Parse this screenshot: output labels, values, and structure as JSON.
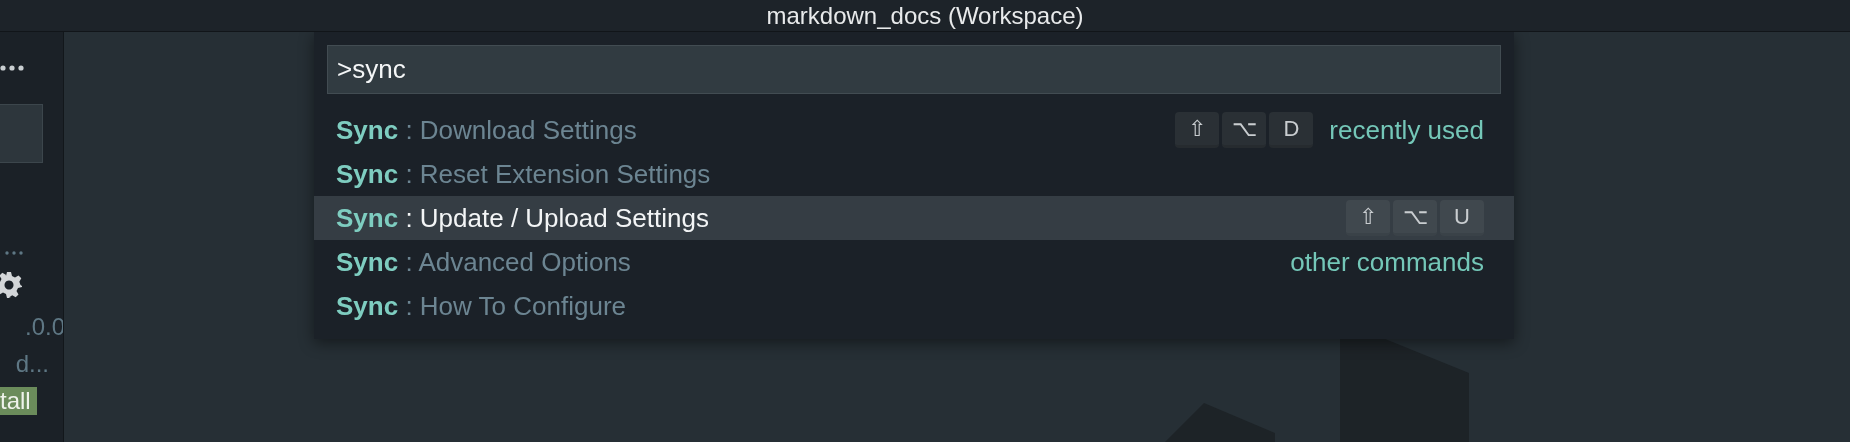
{
  "window": {
    "title": "markdown_docs (Workspace)"
  },
  "sidebar": {
    "version": ".0.0",
    "description": "d...",
    "badge": "tall"
  },
  "command_palette": {
    "input": {
      "value": ">sync"
    },
    "items": [
      {
        "label": "**Sync** : Download Settings",
        "keys": [
          "⇧",
          "⌥",
          "D"
        ],
        "note": "recently used",
        "selected": false
      },
      {
        "label": "**Sync** : Reset Extension Settings",
        "selected": false
      },
      {
        "label": "**Sync** : Update / Upload Settings",
        "keys": [
          "⇧",
          "⌥",
          "U"
        ],
        "selected": true
      },
      {
        "label": "**Sync** : Advanced Options",
        "note": "other commands",
        "selected": false
      },
      {
        "label": "**Sync** : How To Configure",
        "selected": false
      }
    ]
  }
}
